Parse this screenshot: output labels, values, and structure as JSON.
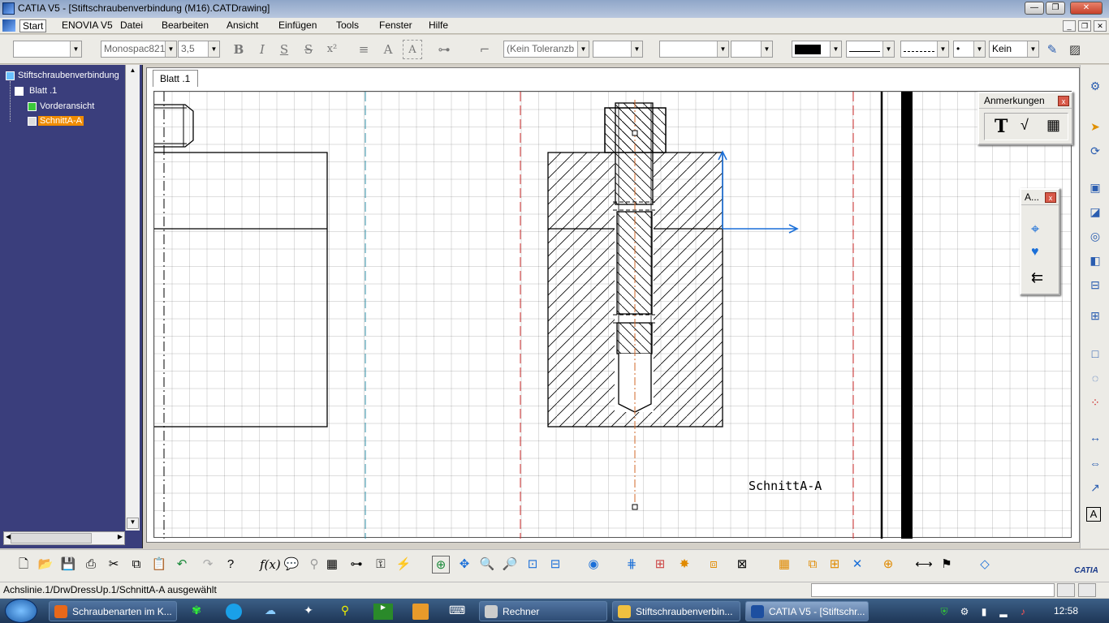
{
  "window": {
    "title": "CATIA V5 - [Stiftschraubenverbindung (M16).CATDrawing]"
  },
  "menu": {
    "items": [
      "Start",
      "ENOVIA V5",
      "Datei",
      "Bearbeiten",
      "Ansicht",
      "Einfügen",
      "Tools",
      "Fenster",
      "Hilfe"
    ]
  },
  "toolbar": {
    "style_combo": "",
    "font_combo": "Monospac821",
    "size_combo": "3,5",
    "bold": "B",
    "italic": "I",
    "underline": "S",
    "strike": "S",
    "superscript": "x²",
    "tolerance_combo": "(Kein Toleranzb",
    "tolerance2_combo": "",
    "combo3": "",
    "combo4": "",
    "fill_none": "Kein"
  },
  "tree": {
    "root": "Stiftschraubenverbindung",
    "sheet": "Blatt .1",
    "view1": "Vorderansicht",
    "view2": "SchnittA-A"
  },
  "sheet_tab": "Blatt .1",
  "drawing": {
    "section_label": "SchnittA-A"
  },
  "panel_annot": {
    "title": "Anmerkungen",
    "close": "x"
  },
  "panel_axis": {
    "title": "A...",
    "close": "x"
  },
  "status": {
    "text": "Achslinie.1/DrwDressUp.1/SchnittA-A ausgewählt"
  },
  "taskbar": {
    "items": [
      "Schraubenarten im K...",
      "Rechner",
      "Stiftschraubenverbin...",
      "CATIA V5 - [Stiftschr..."
    ],
    "clock": "12:58"
  },
  "colors": {
    "tree_bg": "#3a3e7c",
    "selection": "#f08c00",
    "axis_blue": "#1a6fd8",
    "frame_red": "#d22f2f",
    "frame_teal": "#2c8da6"
  }
}
